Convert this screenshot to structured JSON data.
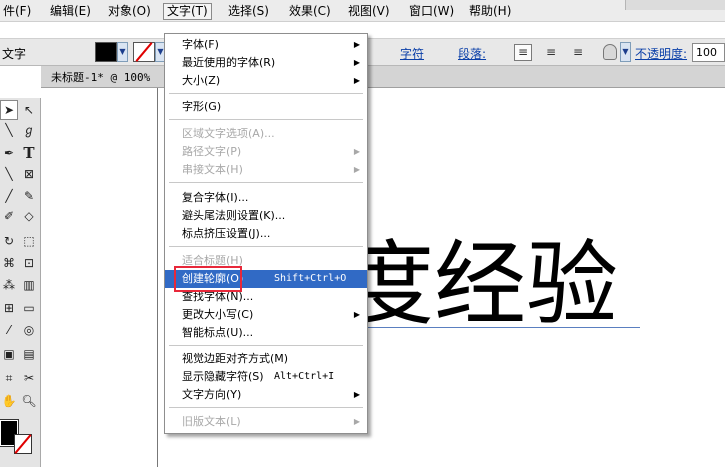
{
  "menubar": {
    "items": [
      "件(F)",
      "编辑(E)",
      "对象(O)",
      "文字(T)",
      "选择(S)",
      "效果(C)",
      "视图(V)",
      "窗口(W)",
      "帮助(H)"
    ]
  },
  "control_bar": {
    "label": "文字",
    "char_link": "字符",
    "para_link": "段落:",
    "opacity_label": "不透明度:",
    "opacity_value": "100"
  },
  "document": {
    "tab_title": "未标题-1* @ 100%",
    "canvas_text": "度经验"
  },
  "type_menu": {
    "items": [
      {
        "label": "字体(F)",
        "shortcut": "",
        "submenu": true,
        "state": "enabled"
      },
      {
        "label": "最近使用的字体(R)",
        "shortcut": "",
        "submenu": true,
        "state": "enabled"
      },
      {
        "label": "大小(Z)",
        "shortcut": "",
        "submenu": true,
        "state": "enabled"
      },
      {
        "label": "字形(G)",
        "shortcut": "",
        "submenu": false,
        "state": "enabled"
      },
      {
        "label": "区域文字选项(A)...",
        "shortcut": "",
        "submenu": false,
        "state": "disabled"
      },
      {
        "label": "路径文字(P)",
        "shortcut": "",
        "submenu": true,
        "state": "disabled"
      },
      {
        "label": "串接文本(H)",
        "shortcut": "",
        "submenu": true,
        "state": "disabled"
      },
      {
        "label": "复合字体(I)...",
        "shortcut": "",
        "submenu": false,
        "state": "enabled"
      },
      {
        "label": "避头尾法则设置(K)...",
        "shortcut": "",
        "submenu": false,
        "state": "enabled"
      },
      {
        "label": "标点挤压设置(J)...",
        "shortcut": "",
        "submenu": false,
        "state": "enabled"
      },
      {
        "label": "适合标题(H)",
        "shortcut": "",
        "submenu": false,
        "state": "disabled"
      },
      {
        "label": "创建轮廓(O)",
        "shortcut": "Shift+Ctrl+O",
        "submenu": false,
        "state": "highlighted"
      },
      {
        "label": "查找字体(N)...",
        "shortcut": "",
        "submenu": false,
        "state": "enabled"
      },
      {
        "label": "更改大小写(C)",
        "shortcut": "",
        "submenu": true,
        "state": "enabled"
      },
      {
        "label": "智能标点(U)...",
        "shortcut": "",
        "submenu": false,
        "state": "enabled"
      },
      {
        "label": "视觉边距对齐方式(M)",
        "shortcut": "",
        "submenu": false,
        "state": "enabled"
      },
      {
        "label": "显示隐藏字符(S)",
        "shortcut": "Alt+Ctrl+I",
        "submenu": false,
        "state": "enabled"
      },
      {
        "label": "文字方向(Y)",
        "shortcut": "",
        "submenu": true,
        "state": "enabled"
      },
      {
        "label": "旧版文本(L)",
        "shortcut": "",
        "submenu": true,
        "state": "disabled"
      }
    ]
  },
  "icons": {
    "selection_tool": "arrow-icon",
    "direct_selection_tool": "hollow-arrow-icon",
    "type_tool": "type-icon",
    "zoom_tool": "zoom-icon",
    "submenu_arrow": "submenu-arrow-icon"
  },
  "colors": {
    "menu_highlight": "#316ac5",
    "annotation_red": "#e8283a",
    "stroke_none_red": "#e00000"
  }
}
